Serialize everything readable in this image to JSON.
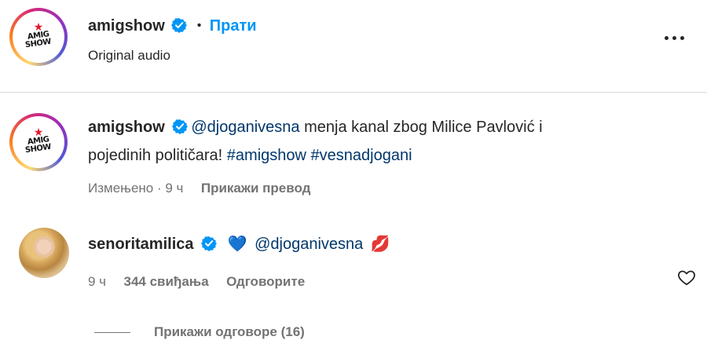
{
  "header": {
    "username": "amigshow",
    "dot": "•",
    "follow_label": "Прати",
    "subtitle": "Original audio",
    "more_icon": "more-horizontal-icon"
  },
  "avatar_logo": {
    "line1": "AMIG",
    "line2": "SHOW",
    "star_color": "#e3182d"
  },
  "caption": {
    "username": "amigshow",
    "mention": "@djoganivesna",
    "text1": " menja kanal zbog Milice Pavlović i",
    "text2": "pojedinih političara! ",
    "hashtag1": "#amigshow",
    "hashtag2": "#vesnadjogani",
    "meta_edited": "Измењено · 9 ч",
    "meta_translate": "Прикажи превод"
  },
  "comment": {
    "username": "senoritamilica",
    "heart_emoji": "💙",
    "mention": "@djoganivesna",
    "lips_emoji": "💋",
    "time": "9 ч",
    "likes": "344 свиђања",
    "reply": "Одговорите",
    "view_replies": "Прикажи одговоре (16)"
  },
  "colors": {
    "follow": "#0095f6",
    "link": "#00376b",
    "verified": "#0095f6",
    "muted": "#737373"
  }
}
